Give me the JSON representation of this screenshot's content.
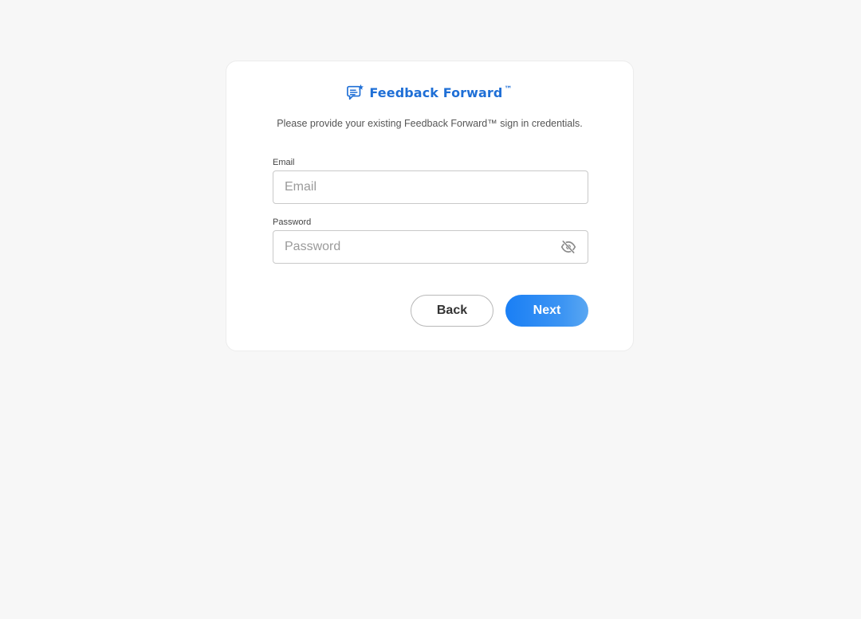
{
  "brand": {
    "name": "Feedback Forward",
    "trademark": "™",
    "color": "#1f6fd6",
    "icon": "feedback-chat-star-icon"
  },
  "subtitle": "Please provide your existing Feedback Forward™ sign in credentials.",
  "email": {
    "label": "Email",
    "placeholder": "Email",
    "value": ""
  },
  "password": {
    "label": "Password",
    "placeholder": "Password",
    "value": "",
    "visibility_icon": "eye-slash-icon"
  },
  "actions": {
    "back_label": "Back",
    "next_label": "Next",
    "next_color": "#1a7ff5"
  }
}
